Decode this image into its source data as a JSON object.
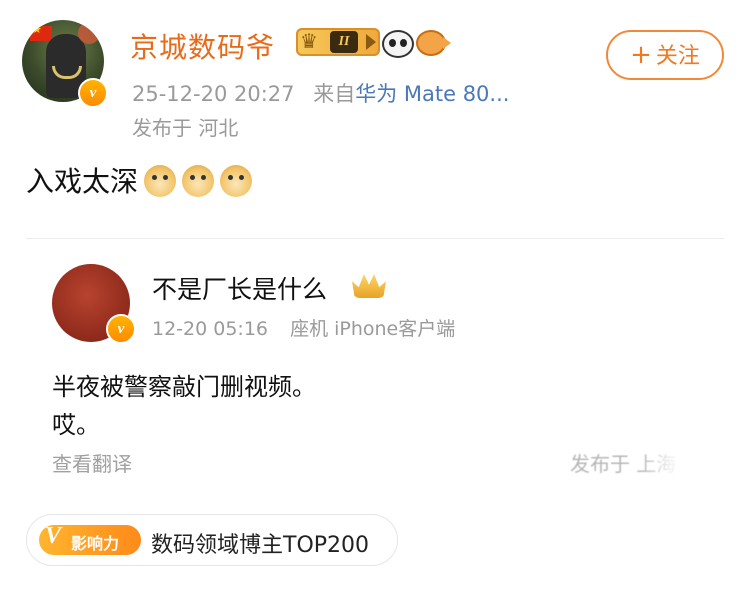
{
  "author": {
    "name": "京城数码爷",
    "level": "II",
    "timestamp": "25-12-20 20:27",
    "source_prefix": "来自",
    "device": "华为 Mate 80...",
    "location": "发布于 河北",
    "avatar_badge": "v"
  },
  "follow_button": {
    "label": "关注",
    "icon": "plus-icon"
  },
  "post": {
    "text": "入戏太深"
  },
  "quoted": {
    "name": "不是厂长是什么",
    "timestamp": "12-20 05:16",
    "source": "座机 iPhone客户端",
    "text_line1": "半夜被警察敲门删视频。",
    "text_line2": "哎。",
    "translate": "查看翻译",
    "location": "发布于 上海",
    "avatar_badge": "v"
  },
  "influence": {
    "badge_letter": "V",
    "badge_label": "影响力",
    "text": "数码领域博主TOP200"
  },
  "colors": {
    "accent_orange": "#f07a22",
    "name_orange": "#e86b1a",
    "link_blue": "#4a78b8",
    "muted_gray": "#9a9a9a"
  }
}
